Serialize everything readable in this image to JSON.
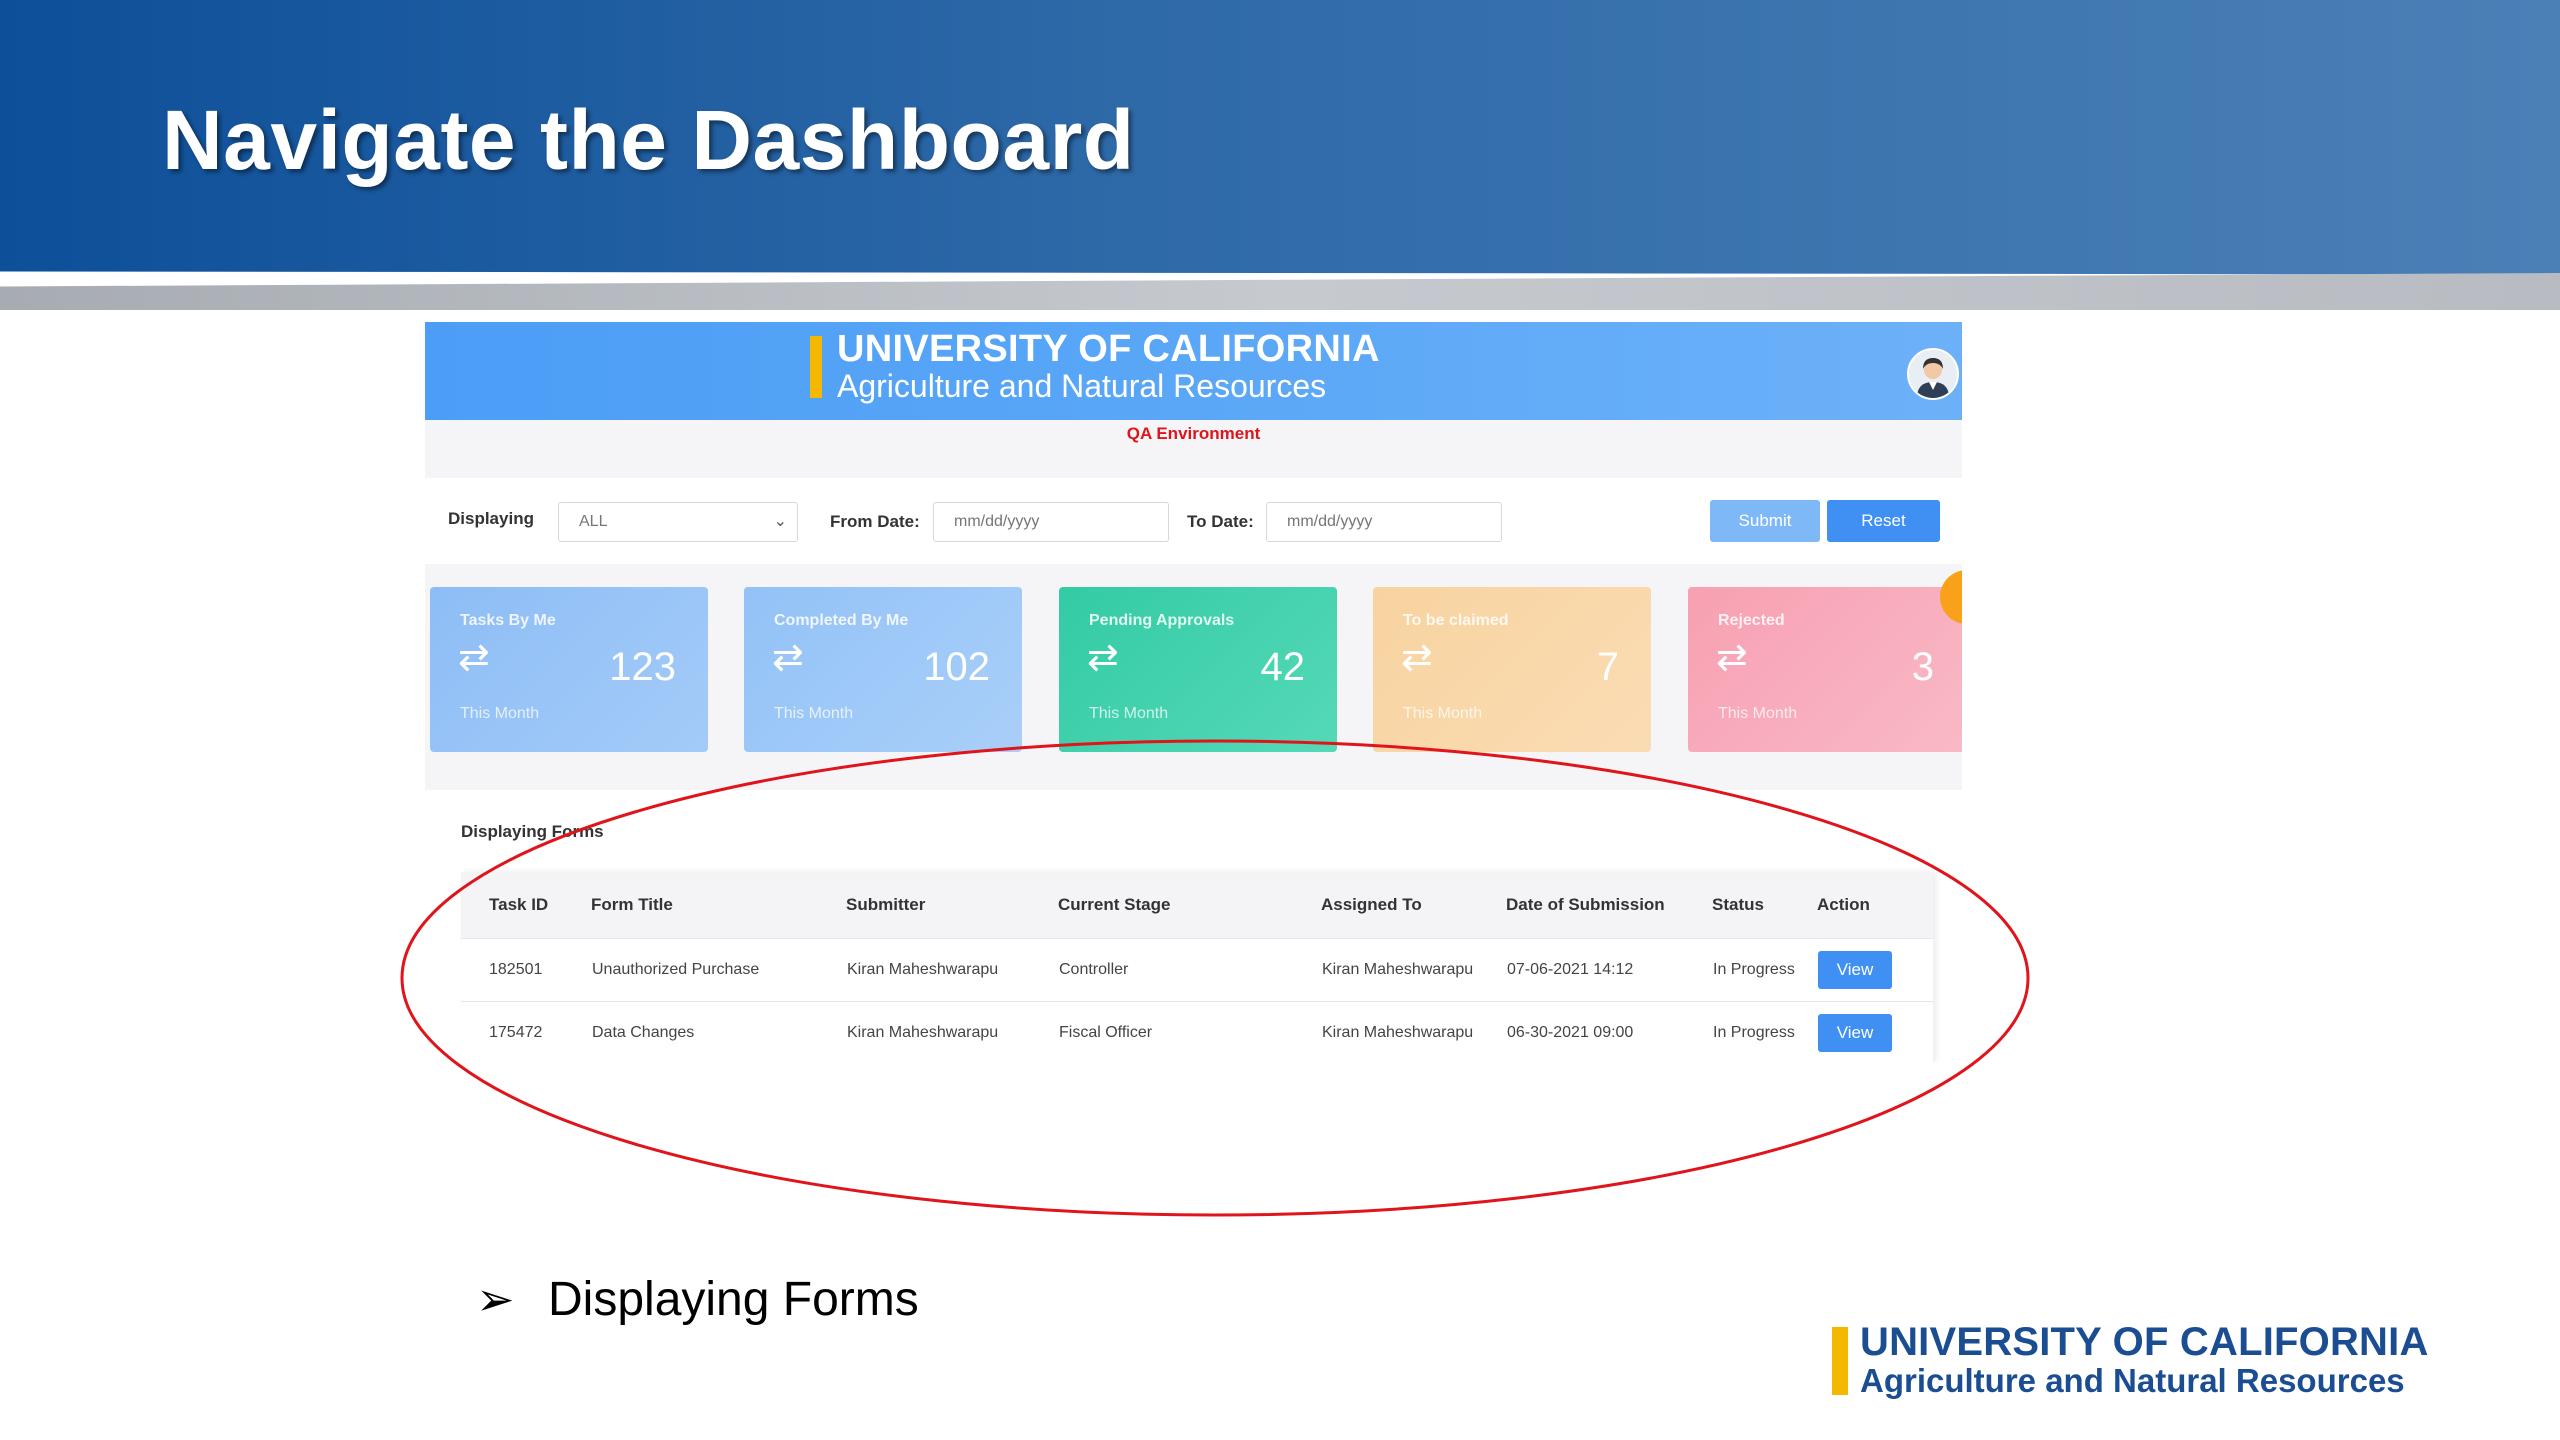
{
  "slide": {
    "title": "Navigate the Dashboard",
    "bullet": "Displaying Forms",
    "logo_line1": "UNIVERSITY OF CALIFORNIA",
    "logo_line2": "Agriculture and Natural Resources"
  },
  "app": {
    "brand_line1": "UNIVERSITY OF CALIFORNIA",
    "brand_line2": "Agriculture and Natural Resources",
    "environment": "QA Environment",
    "filters": {
      "displaying_label": "Displaying",
      "displaying_value": "ALL",
      "from_label": "From Date:",
      "from_placeholder": "mm/dd/yyyy",
      "to_label": "To Date:",
      "to_placeholder": "mm/dd/yyyy",
      "submit_label": "Submit",
      "reset_label": "Reset"
    },
    "cards": [
      {
        "label": "Tasks By Me",
        "value": "123",
        "period": "This Month"
      },
      {
        "label": "Completed By Me",
        "value": "102",
        "period": "This Month"
      },
      {
        "label": "Pending Approvals",
        "value": "42",
        "period": "This Month"
      },
      {
        "label": "To be claimed",
        "value": "7",
        "period": "This Month"
      },
      {
        "label": "Rejected",
        "value": "3",
        "period": "This Month"
      }
    ],
    "forms": {
      "title": "Displaying Forms",
      "columns": [
        "Task ID",
        "Form Title",
        "Submitter",
        "Current Stage",
        "Assigned To",
        "Date of Submission",
        "Status",
        "Action"
      ],
      "rows": [
        {
          "task_id": "182501",
          "form_title": "Unauthorized Purchase",
          "submitter": "Kiran Maheshwarapu",
          "stage": "Controller",
          "assigned": "Kiran Maheshwarapu",
          "date": "07-06-2021 14:12",
          "status": "In Progress",
          "action": "View"
        },
        {
          "task_id": "175472",
          "form_title": "Data Changes",
          "submitter": "Kiran Maheshwarapu",
          "stage": "Fiscal Officer",
          "assigned": "Kiran Maheshwarapu",
          "date": "06-30-2021 09:00",
          "status": "In Progress",
          "action": "View"
        }
      ]
    }
  },
  "colors": {
    "banner_blue": "#0d4f99",
    "app_header_blue": "#4b9df6",
    "accent_blue": "#3f90f2",
    "brand_gold": "#f5b800",
    "annotation_red": "#e0141b",
    "logo_navy": "#1a4d91"
  },
  "icons": {
    "card_icon": "refresh-icon",
    "select_icon": "chevron-down-icon",
    "bullet_icon": "arrow-bullet-icon",
    "avatar_icon": "user-avatar-icon"
  }
}
